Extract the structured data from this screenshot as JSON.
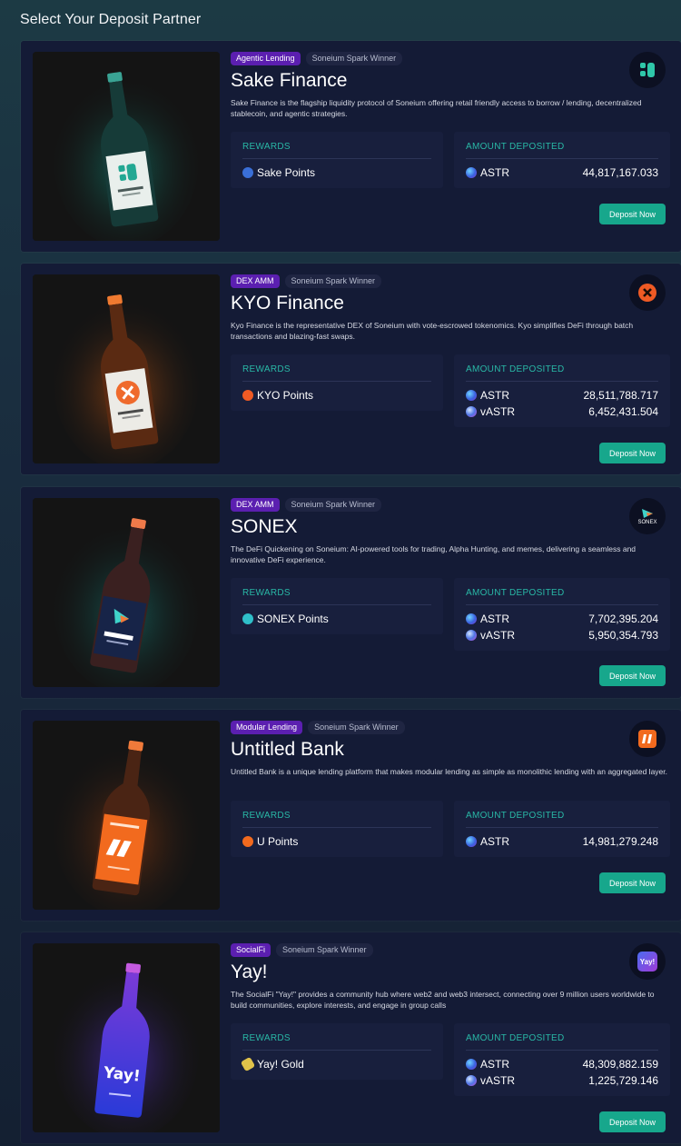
{
  "page_title": "Select Your Deposit Partner",
  "labels": {
    "rewards": "REWARDS",
    "amount_deposited": "AMOUNT DEPOSITED",
    "deposit_button": "Deposit Now"
  },
  "colors": {
    "background": "#172538",
    "card": "#141b36",
    "box": "#181f3d",
    "accent_teal": "#29b8a6",
    "button": "#17a78c",
    "category_tag": "#5b1fb0"
  },
  "partners": [
    {
      "category": "Agentic Lending",
      "award": "Soneium Spark Winner",
      "name": "Sake Finance",
      "description": "Sake Finance is the flagship liquidity protocol of Soneium offering retail friendly access to borrow / lending, decentralized stablecoin, and agentic strategies.",
      "logo_icon": "sake-finance-logo-icon",
      "reward": "Sake Points",
      "reward_icon": "sake-points-icon",
      "deposits": [
        {
          "token": "ASTR",
          "amount": "44,817,167.033"
        }
      ]
    },
    {
      "category": "DEX AMM",
      "award": "Soneium Spark Winner",
      "name": "KYO Finance",
      "description": "Kyo Finance is the representative DEX of Soneium with vote-escrowed tokenomics. Kyo simplifies DeFi through batch transactions and blazing-fast swaps.",
      "logo_icon": "kyo-finance-logo-icon",
      "reward": "KYO Points",
      "reward_icon": "kyo-points-icon",
      "deposits": [
        {
          "token": "ASTR",
          "amount": "28,511,788.717"
        },
        {
          "token": "vASTR",
          "amount": "6,452,431.504"
        }
      ]
    },
    {
      "category": "DEX AMM",
      "award": "Soneium Spark Winner",
      "name": "SONEX",
      "description": "The DeFi Quickening on Soneium: AI-powered tools for trading, Alpha Hunting, and memes, delivering a seamless and innovative DeFi experience.",
      "logo_icon": "sonex-logo-icon",
      "logo_text": "SONEX",
      "reward": "SONEX Points",
      "reward_icon": "sonex-points-icon",
      "deposits": [
        {
          "token": "ASTR",
          "amount": "7,702,395.204"
        },
        {
          "token": "vASTR",
          "amount": "5,950,354.793"
        }
      ]
    },
    {
      "category": "Modular Lending",
      "award": "Soneium Spark Winner",
      "name": "Untitled Bank",
      "description": "Untitled Bank is a unique lending platform that makes modular lending as simple as monolithic lending with an aggregated layer.",
      "logo_icon": "untitled-bank-logo-icon",
      "reward": "U Points",
      "reward_icon": "u-points-icon",
      "deposits": [
        {
          "token": "ASTR",
          "amount": "14,981,279.248"
        }
      ]
    },
    {
      "category": "SocialFi",
      "award": "Soneium Spark Winner",
      "name": "Yay!",
      "description": "The SocialFi \"Yay!\" provides a community hub where web2 and web3 intersect, connecting over 9 million users worldwide to build communities, explore interests, and engage in group calls",
      "logo_icon": "yay-logo-icon",
      "logo_text": "Yay!",
      "reward": "Yay! Gold",
      "reward_icon": "yay-gold-icon",
      "deposits": [
        {
          "token": "ASTR",
          "amount": "48,309,882.159"
        },
        {
          "token": "vASTR",
          "amount": "1,225,729.146"
        }
      ]
    }
  ]
}
